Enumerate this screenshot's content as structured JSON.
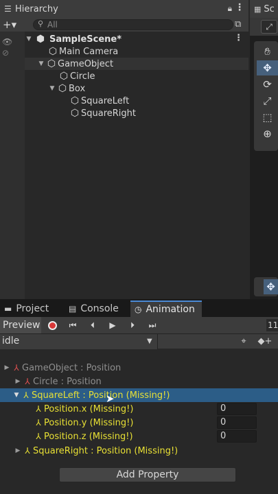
{
  "hierarchy": {
    "tab_label": "Hierarchy",
    "icons": {
      "tab": "list-icon",
      "lock": "lock-icon",
      "menu": "kebab-menu-icon",
      "add": "plus-icon",
      "search": "search-icon",
      "search_mode": "scene-search-icon"
    },
    "add_label": "+▾",
    "search_placeholder": "All",
    "scene": {
      "name": "SampleScene*"
    },
    "items": [
      {
        "label": "Main Camera"
      },
      {
        "label": "GameObject"
      },
      {
        "label": "Circle"
      },
      {
        "label": "Box"
      },
      {
        "label": "SquareLeft"
      },
      {
        "label": "SquareRight"
      }
    ]
  },
  "scene_panel": {
    "tab_label": "Sc",
    "tools": [
      "hand-tool-icon",
      "move-tool-icon",
      "rotate-tool-icon",
      "scale-tool-icon",
      "rect-tool-icon",
      "transform-tool-icon"
    ]
  },
  "bottom_tabs": {
    "project": "Project",
    "console": "Console",
    "animation": "Animation"
  },
  "animation": {
    "preview_label": "Preview",
    "frame_value": "11",
    "clip_name": "idle",
    "properties": [
      {
        "label": "GameObject : Position",
        "state": "gray"
      },
      {
        "label": "Circle : Position",
        "state": "gray"
      },
      {
        "label": "SquareLeft : Position (Missing!)",
        "state": "missing-selected"
      },
      {
        "label": "Position.x (Missing!)",
        "value": "0"
      },
      {
        "label": "Position.y (Missing!)",
        "value": "0"
      },
      {
        "label": "Position.z (Missing!)",
        "value": "0"
      },
      {
        "label": "SquareRight : Position (Missing!)",
        "state": "missing"
      }
    ],
    "add_property_label": "Add Property"
  },
  "colors": {
    "selection": "#2c5d87",
    "missing_text": "#e8e034",
    "record": "#d83838",
    "active_tab_accent": "#4a8ad6"
  }
}
